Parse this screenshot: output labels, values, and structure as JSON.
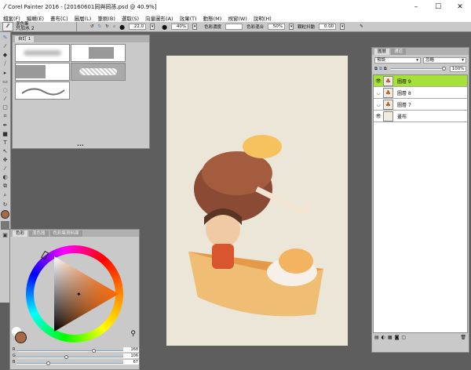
{
  "window": {
    "title": "Corel Painter 2016 - [20160601同與同孫.psd @ 40.9%]",
    "controls": [
      "–",
      "☐",
      "✕"
    ]
  },
  "menu": [
    "檔案(F)",
    "編輯(E)",
    "畫布(C)",
    "圖層(L)",
    "筆刷(B)",
    "選取(S)",
    "向量圖形(A)",
    "效果(T)",
    "動態(M)",
    "視窗(W)",
    "說明(H)"
  ],
  "propbar": {
    "brush_category": "混色筆",
    "brush_variant": "只加水 2",
    "size": "22.0",
    "opacity": "40%",
    "color_conc_label": "色彩濃度",
    "color_conc": "",
    "color_mix_label": "色彩混合",
    "color_mix": "50%",
    "jitter_label": "顆粒抖動",
    "jitter": "0.00"
  },
  "brush_panel": {
    "tab": "自訂 1"
  },
  "layers_panel": {
    "tabs": [
      "圖層",
      "通道"
    ],
    "blend_mode": "預設",
    "composite": "忽略",
    "opacity": "100%",
    "layers": [
      {
        "name": "圖層 9",
        "selected": true,
        "visible": true
      },
      {
        "name": "圖層 8",
        "selected": false,
        "visible": false
      },
      {
        "name": "圖層 7",
        "selected": false,
        "visible": false
      },
      {
        "name": "畫布",
        "selected": false,
        "visible": true
      }
    ]
  },
  "color_panel": {
    "tabs": [
      "色彩",
      "混色器",
      "色彩集資料庫"
    ],
    "current_color": "#a86a43",
    "rgb": [
      {
        "label": "R",
        "value": "168",
        "fraction": 0.66
      },
      {
        "label": "G",
        "value": "106",
        "fraction": 0.42
      },
      {
        "label": "B",
        "value": "67",
        "fraction": 0.26
      }
    ]
  },
  "colors": {
    "accent_selected_layer": "#a6e03a",
    "paper": "#ece6d8"
  }
}
